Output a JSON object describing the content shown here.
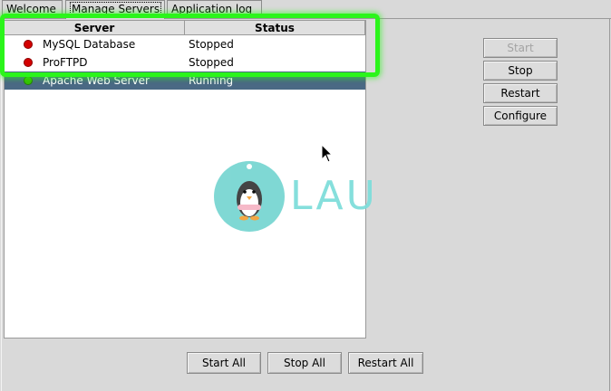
{
  "tabs": [
    {
      "label": "Welcome"
    },
    {
      "label": "Manage Servers"
    },
    {
      "label": "Application log"
    }
  ],
  "server_list": {
    "columns": [
      "Server",
      "Status"
    ],
    "rows": [
      {
        "name": "MySQL Database",
        "status": "Stopped",
        "indicator_color": "#d40000"
      },
      {
        "name": "ProFTPD",
        "status": "Stopped",
        "indicator_color": "#d40000"
      },
      {
        "name": "Apache Web Server",
        "status": "Running",
        "indicator_color": "#35c000"
      }
    ]
  },
  "logo": {
    "text": "LAU"
  },
  "side_buttons": {
    "start": "Start",
    "stop": "Stop",
    "restart": "Restart",
    "configure": "Configure"
  },
  "bottom_buttons": {
    "start_all": "Start All",
    "stop_all": "Stop All",
    "restart_all": "Restart All"
  },
  "colors": {
    "highlight": "#2bf51b",
    "selection": "#4a6984"
  }
}
